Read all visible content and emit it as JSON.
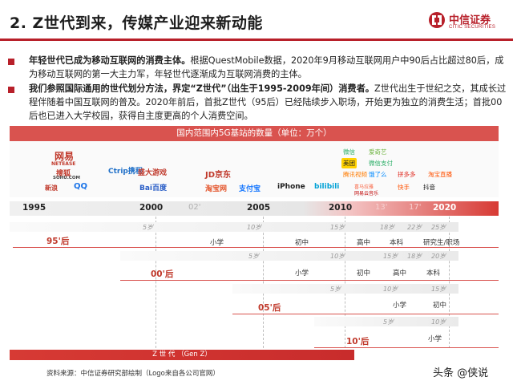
{
  "header": {
    "title": "2. Z世代到来，传媒产业迎来新动能",
    "logo_cn": "中信证券",
    "logo_en": "CITIC SECURITIES",
    "accent_color": "#b8202a"
  },
  "paragraphs": [
    {
      "lead": "年轻世代已成为移动互联网的消费主体。",
      "body": "根据QuestMobile数据，2020年9月移动互联网用户中90后占比超过80后，成为移动互联网的第一大主力军，年轻世代逐渐成为互联网消费的主体。"
    },
    {
      "lead": "我们参照国际通用的世代划分方法，界定“Z世代”（出生于1995-2009年间）消费者。",
      "body": "Z世代出生于世纪之交，其成长过程伴随着中国互联网的普及。2020年前后，首批Z世代（95后）已经陆续步入职场，开始更为独立的消费生活；首批00后也已进入大学校园，获得自主度更高的个人消费空间。"
    }
  ],
  "chart": {
    "title": "国内范围内5G基站的数量（单位：万个）",
    "logos_1995": [
      "网易",
      "NETEASE",
      "搜狐",
      "SOHU.COM",
      "新浪",
      "QQ"
    ],
    "logos_2000": [
      "Ctrip携程",
      "盛大游戏",
      "Bai百度"
    ],
    "logos_2005": [
      "JD京东",
      "淘宝网",
      "支付宝",
      "iPhone",
      "bilibili"
    ],
    "logos_2010": [
      "微信",
      "爱奇艺",
      "美团",
      "微信支付",
      "腾讯视频",
      "饿了么",
      "拼多多",
      "淘宝直播",
      "快手",
      "抖音",
      "喜马拉雅",
      "网易云音乐"
    ],
    "timeline": {
      "years": [
        "1995",
        "2000",
        "2005",
        "2010",
        "2020"
      ],
      "years_light": [
        "02'",
        "13'",
        "17'"
      ]
    },
    "rows": [
      {
        "cohort": "95'后",
        "ages": [
          "5岁",
          "10岁",
          "15岁",
          "18岁",
          "22岁",
          "25岁"
        ],
        "stages": [
          "小学",
          "初中",
          "高中",
          "本科",
          "研究生/职场"
        ]
      },
      {
        "cohort": "00'后",
        "ages": [
          "5岁",
          "10岁",
          "15岁",
          "18岁",
          "20岁"
        ],
        "stages": [
          "小学",
          "初中",
          "高中",
          "本科"
        ]
      },
      {
        "cohort": "05'后",
        "ages": [
          "5岁",
          "10岁",
          "15岁"
        ],
        "stages": [
          "小学",
          "初中"
        ]
      },
      {
        "cohort": "10'后",
        "ages": [
          "5岁",
          "10岁"
        ],
        "stages": [
          "小学"
        ]
      }
    ],
    "genz_label": "Z 世 代 （Gen Z）"
  },
  "source": "资料来源：中信证券研究部绘制（Logo来自各公司官网）",
  "watermark": "头条 @侠说"
}
